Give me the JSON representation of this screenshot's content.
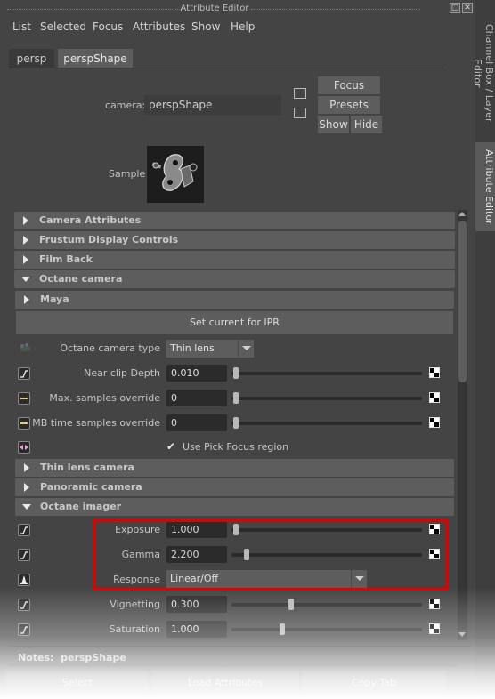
{
  "window": {
    "title": "Attribute Editor",
    "float_icon": "float-window-icon",
    "close_icon": "close-icon"
  },
  "menu": [
    "List",
    "Selected",
    "Focus",
    "Attributes",
    "Show",
    "Help"
  ],
  "tabs": [
    {
      "label": "persp",
      "active": false
    },
    {
      "label": "perspShape",
      "active": true
    }
  ],
  "side_tabs": [
    {
      "label": "Channel Box / Layer Editor",
      "active": false
    },
    {
      "label": "Attribute Editor",
      "active": true
    }
  ],
  "camera": {
    "label": "camera:",
    "value": "perspShape",
    "icons": [
      "input-connection-icon",
      "output-connection-icon"
    ],
    "buttons": {
      "focus": "Focus",
      "presets": "Presets",
      "show": "Show",
      "hide": "Hide"
    }
  },
  "sample": {
    "label": "Sample",
    "icon": "camera-swatch-icon"
  },
  "sections": {
    "camera_attributes": {
      "label": "Camera Attributes",
      "expanded": false
    },
    "frustum": {
      "label": "Frustum Display Controls",
      "expanded": false
    },
    "film_back": {
      "label": "Film Back",
      "expanded": false
    },
    "octane_camera": {
      "label": "Octane camera",
      "expanded": true
    },
    "maya": {
      "label": "Maya",
      "expanded": false
    },
    "set_ipr": "Set current for IPR",
    "thin_lens": {
      "label": "Thin lens camera",
      "expanded": false
    },
    "panoramic": {
      "label": "Panoramic camera",
      "expanded": false
    },
    "octane_imager": {
      "label": "Octane imager",
      "expanded": true
    }
  },
  "octane_camera": {
    "type_label": "Octane camera type",
    "type_value": "Thin lens",
    "near_clip": {
      "label": "Near clip Depth",
      "value": "0.010",
      "slider": 0.0
    },
    "max_samples": {
      "label": "Max. samples override",
      "value": "0",
      "slider": 0.0
    },
    "mb_samples": {
      "label": "MB time samples override",
      "value": "0",
      "slider": 0.0
    },
    "pick_focus": {
      "label": "Use Pick Focus region",
      "checked": true
    }
  },
  "octane_imager": {
    "exposure": {
      "label": "Exposure",
      "value": "1.000",
      "slider": 0.0
    },
    "gamma": {
      "label": "Gamma",
      "value": "2.200",
      "slider": 0.06
    },
    "response": {
      "label": "Response",
      "value": "Linear/Off"
    },
    "vignetting": {
      "label": "Vignetting",
      "value": "0.300",
      "slider": 0.3
    },
    "saturation": {
      "label": "Saturation",
      "value": "1.000",
      "slider": 0.25
    }
  },
  "highlight_color": "#e00000",
  "notes": {
    "label": "Notes:",
    "value": "perspShape"
  },
  "bottom_buttons": {
    "select": "Select",
    "load": "Load Attributes",
    "copy": "Copy Tab"
  }
}
